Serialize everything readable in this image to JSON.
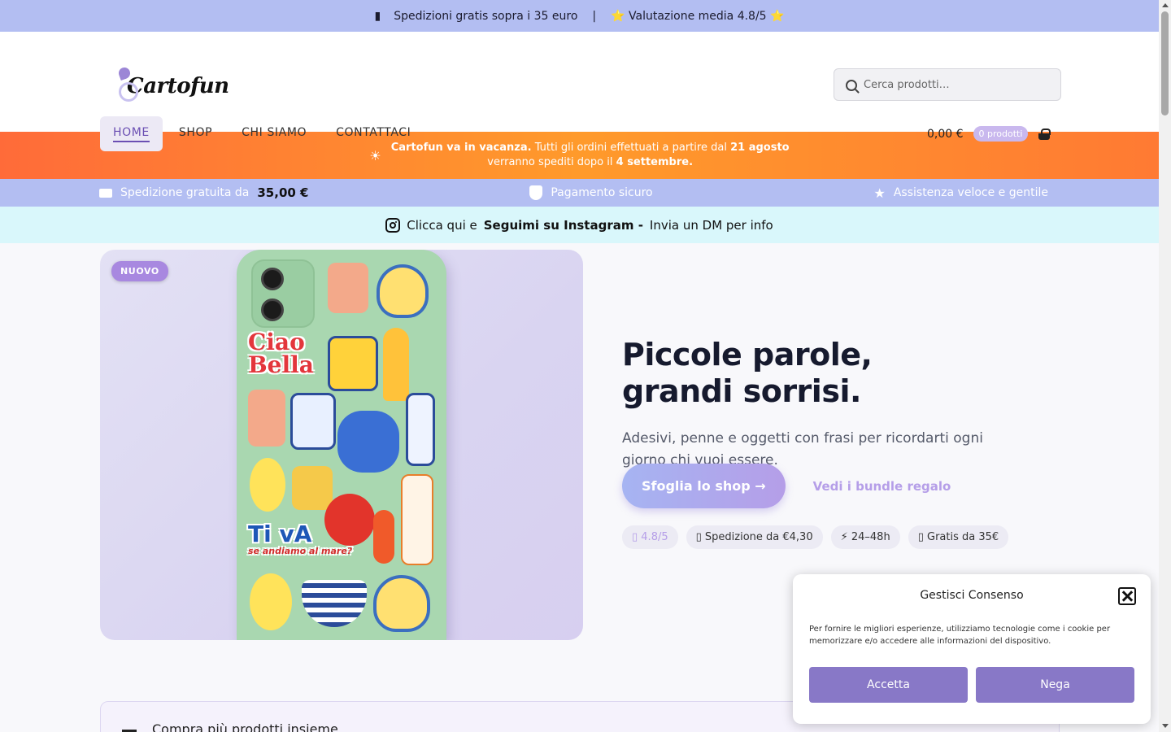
{
  "topbar": {
    "shipping_icon": "truck-icon",
    "shipping_text": "Spedizioni gratis sopra i 35 euro",
    "separator": "|",
    "rating_text": "⭐ Valutazione media 4.8/5 ⭐"
  },
  "header": {
    "logo_text": "Cartofun",
    "search_placeholder": "Cerca prodotti…",
    "nav": [
      {
        "label": "HOME",
        "active": true
      },
      {
        "label": "SHOP"
      },
      {
        "label": "CHI SIAMO"
      },
      {
        "label": "CONTATTACI"
      }
    ],
    "cart_total": "0,00 €",
    "cart_count": "0 prodotti"
  },
  "vacation": {
    "line1_bold": "Cartofun va in vacanza.",
    "line1_rest": "Tutti gli ordini effettuati a partire dal",
    "line1_date": "21 agosto",
    "line2_rest": "verranno spediti dopo il",
    "line2_date": "4 settembre."
  },
  "usp": {
    "shipping_label": "Spedizione gratuita da",
    "shipping_amount": "35,00 €",
    "payment_label": "Pagamento sicuro",
    "support_label": "Assistenza veloce e gentile"
  },
  "instagram": {
    "pre": "Clicca qui e",
    "bold": "Seguimi su Instagram -",
    "post": "Invia un DM per info"
  },
  "hero": {
    "badge": "NUOVO",
    "sticker_text_1a": "Ciao",
    "sticker_text_1b": "Bella",
    "sticker_text_2": "Ti vA",
    "sticker_text_3": "se andiamo al mare?",
    "title_line1": "Piccole parole,",
    "title_line2": "grandi sorrisi.",
    "subtitle": "Adesivi, penne e oggetti con frasi per ricordarti ogni giorno chi vuoi essere.",
    "cta_primary": "Sfoglia lo shop →",
    "cta_secondary": "Vedi i bundle regalo",
    "chips": [
      "▯ 4.8/5",
      "▯ Spedizione da €4,30",
      "⚡ 24–48h",
      "▯ Gratis da 35€"
    ]
  },
  "bundle": {
    "title": "Compra più prodotti insieme"
  },
  "consent": {
    "title": "Gestisci Consenso",
    "description": "Per fornire le migliori esperienze, utilizziamo tecnologie come i cookie per memorizzare e/o accedere alle informazioni del dispositivo.",
    "accept": "Accetta",
    "deny": "Nega"
  },
  "colors": {
    "topbar_bg": "#b3bef2",
    "vacation_orange": "#ff7a33",
    "insta_bg": "#d9f7fb",
    "accent_purple": "#8878c7"
  }
}
